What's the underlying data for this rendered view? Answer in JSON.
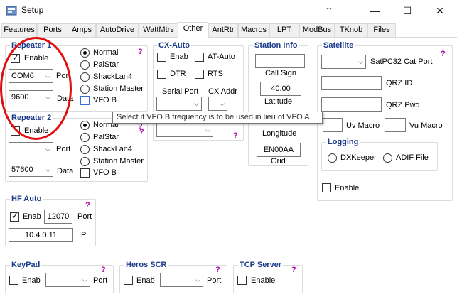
{
  "window": {
    "title": "Setup",
    "minimize": "—",
    "maximize": "☐",
    "close": "✕",
    "cursor_glyph": "↔"
  },
  "tabs": [
    "Features",
    "Ports",
    "Amps",
    "AutoDrive",
    "WattMtrs",
    "Other",
    "AntRtr",
    "Macros",
    "LPT",
    "ModBus",
    "TKnob",
    "Files"
  ],
  "active_tab": "Other",
  "repeater1": {
    "title": "Repeater 1",
    "enable_label": "Enable",
    "enable_checked": true,
    "port_value": "COM6",
    "port_label": "Port",
    "baud_value": "9600",
    "data_label": "Data",
    "radios": [
      "Normal",
      "PalStar",
      "ShackLan4",
      "Station Master"
    ],
    "selected": "Normal",
    "vfob_label": "VFO B",
    "help": "?"
  },
  "repeater2": {
    "title": "Repeater 2",
    "enable_label": "Enable",
    "port_value": "",
    "port_label": "Port",
    "baud_value": "57600",
    "data_label": "Data",
    "radios": [
      "Normal",
      "PalStar",
      "ShackLan4",
      "Station Master"
    ],
    "selected": "Normal",
    "vfob_label": "VFO B",
    "help": "?"
  },
  "cxauto": {
    "title": "CX-Auto",
    "enab_label": "Enab",
    "atauto_label": "AT-Auto",
    "dtr_label": "DTR",
    "rts_label": "RTS",
    "serial_port_label": "Serial Port",
    "cx_addr_label": "CX Addr",
    "help": "?"
  },
  "station_info": {
    "title": "Station Info",
    "call_sign_value": "",
    "call_sign_label": "Call Sign",
    "latitude_value": "40.00",
    "latitude_label": "Latitude",
    "longitude_label": "Longitude",
    "grid_value": "EN00AA",
    "grid_label": "Grid"
  },
  "satellite": {
    "title": "Satellite",
    "satpc_label": "SatPC32 Cat Port",
    "qrz_id_label": "QRZ ID",
    "qrz_pwd_label": "QRZ Pwd",
    "uv_macro_label": "Uv Macro",
    "vu_macro_label": "Vu Macro",
    "help": "?",
    "logging_title": "Logging",
    "dxkeeper_label": "DXKeeper",
    "adif_label": "ADIF File",
    "enable_label": "Enable"
  },
  "hf_auto": {
    "title": "HF Auto",
    "enab_label": "Enab",
    "enab_checked": true,
    "port_value": "12070",
    "port_label": "Port",
    "ip_value": "10.4.0.11",
    "ip_label": "IP",
    "help": "?"
  },
  "keypad": {
    "title": "KeyPad",
    "enab_label": "Enab",
    "port_label": "Port",
    "help": "?"
  },
  "heros": {
    "title": "Heros SCR",
    "enab_label": "Enab",
    "port_label": "Port",
    "help": "?"
  },
  "tcp": {
    "title": "TCP Server",
    "enable_label": "Enable",
    "help": "?"
  },
  "tooltip": "Select if VFO B frequency is to be used in lieu of VFO A.",
  "colors": {
    "annotation_circle": "#e01010",
    "help_mark": "#b000b0",
    "group_title": "#1a3a8a"
  }
}
